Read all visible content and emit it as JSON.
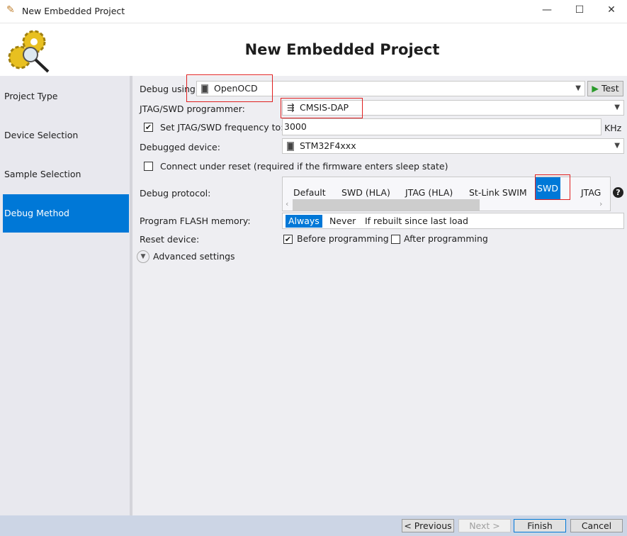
{
  "window": {
    "title": "New Embedded Project",
    "header": "New Embedded Project"
  },
  "sidebar": {
    "items": [
      {
        "label": "Project Type"
      },
      {
        "label": "Device Selection"
      },
      {
        "label": "Sample Selection"
      },
      {
        "label": "Debug Method",
        "active": true
      }
    ]
  },
  "form": {
    "debug_using_label": "Debug using:",
    "debug_using_value": "OpenOCD",
    "test_label": "Test",
    "programmer_label": "JTAG/SWD programmer:",
    "programmer_value": "CMSIS-DAP",
    "freq_label": "Set JTAG/SWD frequency to:",
    "freq_checked": true,
    "freq_value": "3000",
    "freq_unit": "KHz",
    "device_label": "Debugged device:",
    "device_value": "STM32F4xxx",
    "connect_reset_label": "Connect under reset (required if the firmware enters sleep state)",
    "connect_reset_checked": false,
    "protocol_label": "Debug protocol:",
    "protocol_options": [
      "Default",
      "SWD (HLA)",
      "JTAG (HLA)",
      "St-Link SWIM",
      "SWD",
      "JTAG"
    ],
    "protocol_selected": "SWD",
    "flash_label": "Program FLASH memory:",
    "flash_options": [
      "Always",
      "Never",
      "If rebuilt since last load"
    ],
    "flash_selected": "Always",
    "reset_label": "Reset device:",
    "reset_before_label": "Before programming",
    "reset_before_checked": true,
    "reset_after_label": "After programming",
    "reset_after_checked": false,
    "advanced_label": "Advanced settings"
  },
  "footer": {
    "previous": "< Previous",
    "next": "Next >",
    "finish": "Finish",
    "cancel": "Cancel"
  },
  "colors": {
    "accent": "#0078d7",
    "highlight": "#e02020"
  }
}
